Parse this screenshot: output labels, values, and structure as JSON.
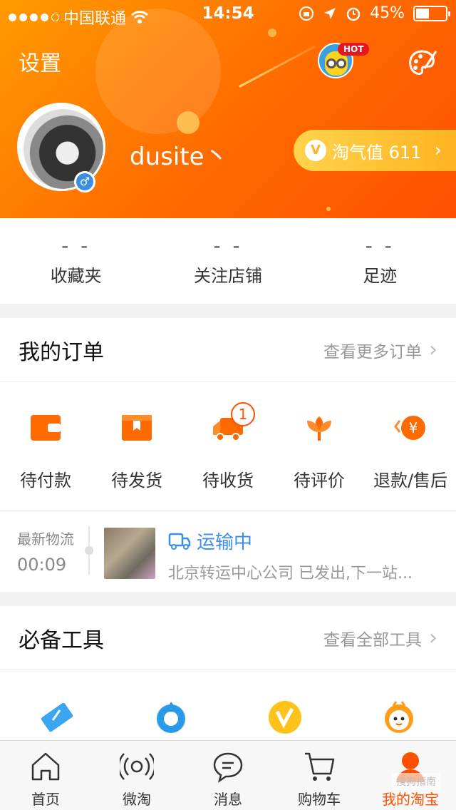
{
  "status_bar": {
    "carrier": "中国联通",
    "time": "14:54",
    "battery": "45%"
  },
  "header": {
    "settings_label": "设置",
    "hot_badge": "HOT",
    "username": "dusite丶",
    "gender_symbol": "♂",
    "naughty_value_label": "淘气值 611",
    "naughty_badge_letter": "V"
  },
  "stats": [
    {
      "value": "- -",
      "label": "收藏夹"
    },
    {
      "value": "- -",
      "label": "关注店铺"
    },
    {
      "value": "- -",
      "label": "足迹"
    }
  ],
  "orders": {
    "title": "我的订单",
    "more_label": "查看更多订单",
    "items": [
      {
        "label": "待付款",
        "icon": "wallet-icon"
      },
      {
        "label": "待发货",
        "icon": "package-icon"
      },
      {
        "label": "待收货",
        "icon": "truck-icon",
        "badge": "1"
      },
      {
        "label": "待评价",
        "icon": "flower-icon"
      },
      {
        "label": "退款/售后",
        "icon": "refund-icon"
      }
    ]
  },
  "logistics": {
    "title": "最新物流",
    "time": "00:09",
    "status": "运输中",
    "description": "北京转运中心公司 已发出,下一站..."
  },
  "tools": {
    "title": "必备工具",
    "more_label": "查看全部工具",
    "items": [
      {
        "icon": "coupon-icon"
      },
      {
        "icon": "service-icon"
      },
      {
        "icon": "v-coin-icon"
      },
      {
        "icon": "bee-icon"
      }
    ]
  },
  "tabbar": [
    {
      "label": "首页",
      "icon": "home-icon"
    },
    {
      "label": "微淘",
      "icon": "broadcast-icon"
    },
    {
      "label": "消息",
      "icon": "message-icon"
    },
    {
      "label": "购物车",
      "icon": "cart-icon"
    },
    {
      "label": "我的淘宝",
      "icon": "profile-icon",
      "active": true
    }
  ],
  "watermark": "搜狗指南",
  "colors": {
    "accent": "#ff5000",
    "header_start": "#ff9a00",
    "link_blue": "#3a8ee6",
    "gold": "#ffb320"
  }
}
